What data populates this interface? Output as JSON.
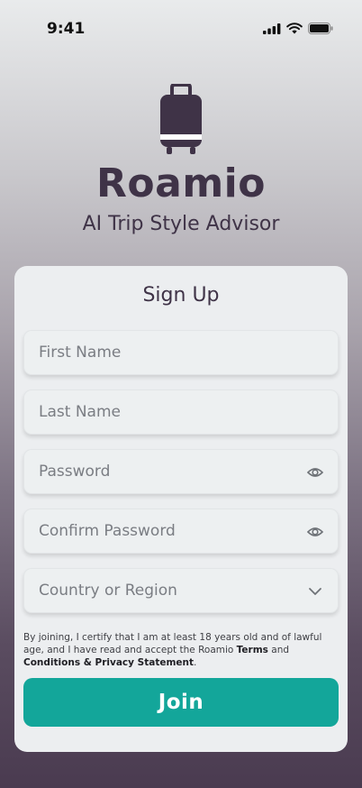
{
  "status_bar": {
    "time": "9:41"
  },
  "brand": {
    "name": "Roamio",
    "tagline": "AI Trip Style Advisor",
    "icon": "suitcase-icon"
  },
  "form": {
    "title": "Sign Up",
    "first_name_placeholder": "First Name",
    "last_name_placeholder": "Last Name",
    "password_placeholder": "Password",
    "confirm_password_placeholder": "Confirm Password",
    "country_placeholder": "Country or Region",
    "legal_text_prefix": "By joining, I certify that I am at least 18 years old and of lawful age, and I have read and accept the Roamio ",
    "legal_link_1": "Terms",
    "legal_text_middle": " and ",
    "legal_link_2": "Conditions & Privacy Statement",
    "legal_text_suffix": ".",
    "join_label": "Join"
  },
  "colors": {
    "accent": "#13a69a",
    "brand_text": "#3f3347",
    "card_bg": "#eceef0"
  }
}
